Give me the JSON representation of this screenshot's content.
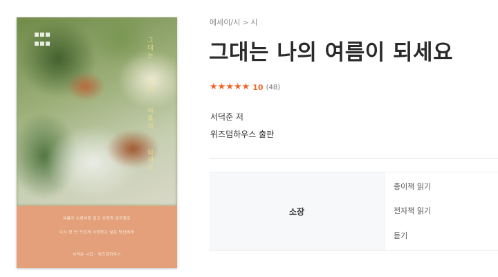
{
  "breadcrumb": {
    "category": "에세이/시",
    "separator": ">",
    "subcategory": "시"
  },
  "book": {
    "title": "그대는 나의 여름이 되세요",
    "rating": {
      "stars": 5,
      "score": "10",
      "count": "(48)"
    },
    "author": "서덕준 저",
    "publisher": "위즈덤하우스 출판"
  },
  "cover": {
    "vertical_lines": [
      "그대는",
      "나의",
      "여름이",
      "되세요"
    ],
    "bottom_lines": [
      "여름의 초록처럼 짙고 선명한 문장들로",
      "다시 한 번 뜨겁게 사랑하고 싶은 당신에게",
      "서덕준 시집 · 위즈덤하우스"
    ]
  },
  "actions": {
    "label": "소장",
    "links": [
      "종이책 읽기",
      "전자책 읽기",
      "듣기"
    ]
  },
  "colors": {
    "accent": "#f2662a",
    "cover_bottom": "#e3a07a"
  }
}
